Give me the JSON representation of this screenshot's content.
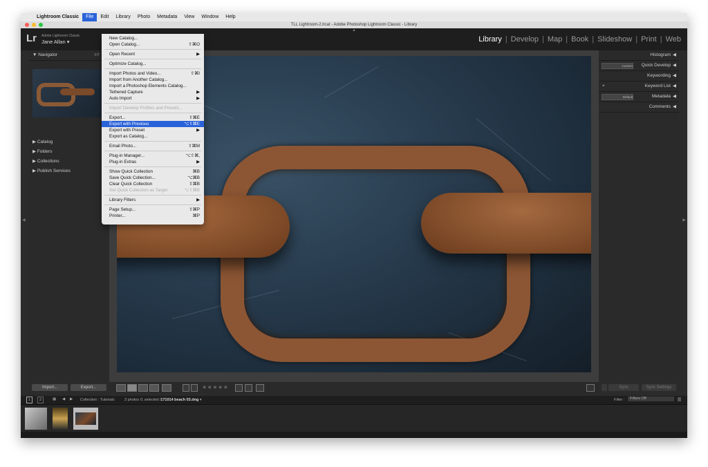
{
  "menubar": {
    "items": [
      "Lightroom Classic",
      "File",
      "Edit",
      "Library",
      "Photo",
      "Metadata",
      "View",
      "Window",
      "Help"
    ]
  },
  "window": {
    "title": "TLL Lightroom-2.lrcat - Adobe Photoshop Lightroom Classic - Library"
  },
  "identity": {
    "logo": "Lr",
    "product": "Adobe Lightroom Classic",
    "user": "Jane Allan",
    "modules": [
      "Library",
      "Develop",
      "Map",
      "Book",
      "Slideshow",
      "Print",
      "Web"
    ],
    "active_module": "Library"
  },
  "left_panel": {
    "navigator": "Navigator",
    "navigator_fit": "FIT",
    "sections": [
      "Catalog",
      "Folders",
      "Collections",
      "Publish Services"
    ]
  },
  "right_panel": {
    "sections": [
      "Histogram",
      "Quick Develop",
      "Keywording",
      "Keyword List",
      "Metadata",
      "Comments"
    ],
    "quick_develop_preset": "Custom",
    "metadata_preset": "Default"
  },
  "buttons": {
    "import": "Import...",
    "export": "Export...",
    "sync": "Sync",
    "sync_settings": "Sync Settings"
  },
  "toolbar": {
    "stars": "★★★★★"
  },
  "filmstrip": {
    "pages": [
      "1",
      "2"
    ],
    "collection": "Collection : Tutorials",
    "count": "3 photos /1 selected /",
    "filename": "171014 beach 03.dng",
    "filter_label": "Filter :",
    "filter_value": "Filters Off"
  },
  "file_menu": {
    "items": [
      {
        "label": "New Catalog...",
        "shortcut": "",
        "disabled": false,
        "highlight": false,
        "submenu": false
      },
      {
        "label": "Open Catalog...",
        "shortcut": "⇧⌘O",
        "disabled": false,
        "highlight": false,
        "submenu": false
      },
      {
        "sep": true
      },
      {
        "label": "Open Recent",
        "shortcut": "▶",
        "disabled": false,
        "highlight": false,
        "submenu": true
      },
      {
        "sep": true
      },
      {
        "label": "Optimize Catalog...",
        "shortcut": "",
        "disabled": false,
        "highlight": false,
        "submenu": false
      },
      {
        "sep": true
      },
      {
        "label": "Import Photos and Video...",
        "shortcut": "⇧⌘I",
        "disabled": false,
        "highlight": false,
        "submenu": false
      },
      {
        "label": "Import from Another Catalog...",
        "shortcut": "",
        "disabled": false,
        "highlight": false,
        "submenu": false
      },
      {
        "label": "Import a Photoshop Elements Catalog...",
        "shortcut": "",
        "disabled": false,
        "highlight": false,
        "submenu": false
      },
      {
        "label": "Tethered Capture",
        "shortcut": "▶",
        "disabled": false,
        "highlight": false,
        "submenu": true
      },
      {
        "label": "Auto Import",
        "shortcut": "▶",
        "disabled": false,
        "highlight": false,
        "submenu": true
      },
      {
        "sep": true
      },
      {
        "label": "Import Develop Profiles and Presets...",
        "shortcut": "",
        "disabled": true,
        "highlight": false,
        "submenu": false
      },
      {
        "sep": true
      },
      {
        "label": "Export...",
        "shortcut": "⇧⌘E",
        "disabled": false,
        "highlight": false,
        "submenu": false
      },
      {
        "label": "Export with Previous",
        "shortcut": "⌥⇧⌘E",
        "disabled": false,
        "highlight": true,
        "submenu": false
      },
      {
        "label": "Export with Preset",
        "shortcut": "▶",
        "disabled": false,
        "highlight": false,
        "submenu": true
      },
      {
        "label": "Export as Catalog...",
        "shortcut": "",
        "disabled": false,
        "highlight": false,
        "submenu": false
      },
      {
        "sep": true
      },
      {
        "label": "Email Photo...",
        "shortcut": "⇧⌘M",
        "disabled": false,
        "highlight": false,
        "submenu": false
      },
      {
        "sep": true
      },
      {
        "label": "Plug-in Manager...",
        "shortcut": "⌥⇧⌘,",
        "disabled": false,
        "highlight": false,
        "submenu": false
      },
      {
        "label": "Plug-in Extras",
        "shortcut": "▶",
        "disabled": false,
        "highlight": false,
        "submenu": true
      },
      {
        "sep": true
      },
      {
        "label": "Show Quick Collection",
        "shortcut": "⌘B",
        "disabled": false,
        "highlight": false,
        "submenu": false
      },
      {
        "label": "Save Quick Collection...",
        "shortcut": "⌥⌘B",
        "disabled": false,
        "highlight": false,
        "submenu": false
      },
      {
        "label": "Clear Quick Collection",
        "shortcut": "⇧⌘B",
        "disabled": false,
        "highlight": false,
        "submenu": false
      },
      {
        "label": "Set Quick Collection as Target",
        "shortcut": "⌥⇧⌘B",
        "disabled": true,
        "highlight": false,
        "submenu": false
      },
      {
        "sep": true
      },
      {
        "label": "Library Filters",
        "shortcut": "▶",
        "disabled": false,
        "highlight": false,
        "submenu": true
      },
      {
        "sep": true
      },
      {
        "label": "Page Setup...",
        "shortcut": "⇧⌘P",
        "disabled": false,
        "highlight": false,
        "submenu": false
      },
      {
        "label": "Printer...",
        "shortcut": "⌘P",
        "disabled": false,
        "highlight": false,
        "submenu": false
      }
    ]
  },
  "colors": {
    "highlight": "#2a62d9",
    "chain": "#8c5634"
  }
}
